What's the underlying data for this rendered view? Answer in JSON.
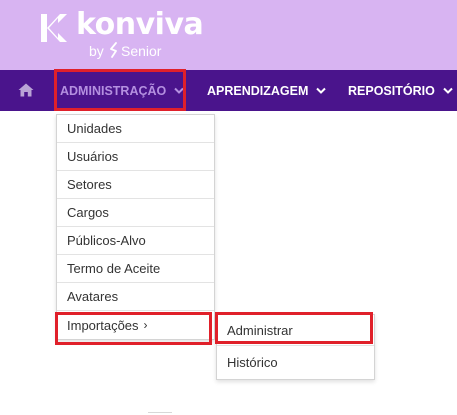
{
  "header": {
    "logo_text": "konviva",
    "logo_by": "by",
    "logo_senior": "Senior",
    "brand_color": "#d8b4f2"
  },
  "navbar": {
    "background": "#4a148c",
    "items": [
      {
        "label": "ADMINISTRAÇÃO",
        "active": true
      },
      {
        "label": "APRENDIZAGEM",
        "active": false
      },
      {
        "label": "REPOSITÓRIO",
        "active": false
      }
    ]
  },
  "admin_menu": {
    "items": [
      {
        "label": "Unidades"
      },
      {
        "label": "Usuários"
      },
      {
        "label": "Setores"
      },
      {
        "label": "Cargos"
      },
      {
        "label": "Públicos-Alvo"
      },
      {
        "label": "Termo de Aceite"
      },
      {
        "label": "Avatares"
      },
      {
        "label": "Importações",
        "has_submenu": true
      }
    ]
  },
  "import_submenu": {
    "items": [
      {
        "label": "Administrar"
      },
      {
        "label": "Histórico"
      }
    ]
  },
  "highlight_color": "#e0202a"
}
